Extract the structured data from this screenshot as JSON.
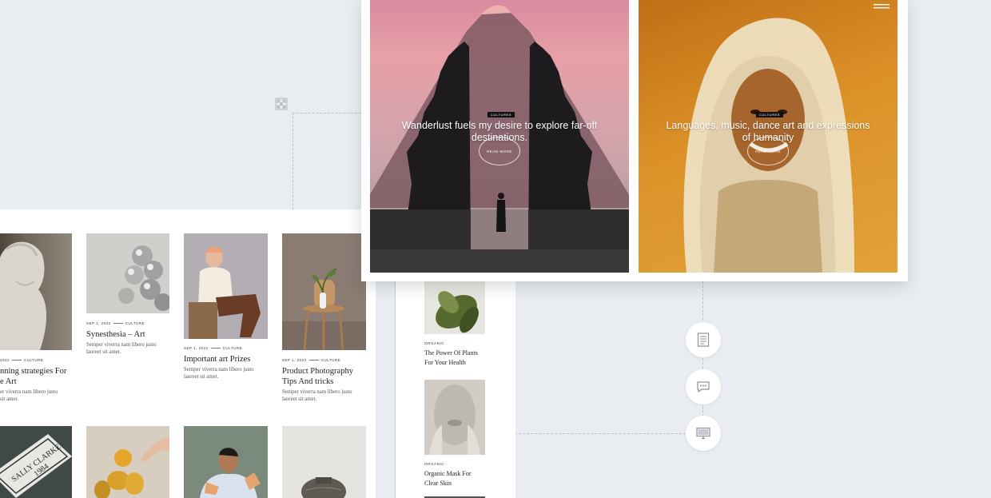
{
  "grid": {
    "row1": [
      {
        "meta_date": "2022",
        "meta_cat": "CULTURE",
        "title": "nning strategies For\ne Art",
        "excerpt": "er viverra nam libero justo\nsit amet."
      },
      {
        "meta_date": "SEP 1, 2022",
        "meta_cat": "CULTURE",
        "title": "Synesthesia – Art",
        "excerpt": "Semper viverra nam libero justo\nlaoreet sit amet."
      },
      {
        "meta_date": "SEP 1, 2022",
        "meta_cat": "CULTURE",
        "title": "Important art Prizes",
        "excerpt": "Semper viverra nam libero justo\nlaoreet sit amet."
      },
      {
        "meta_date": "SEP 1, 2022",
        "meta_cat": "CULTURE",
        "title": "Product Photography\nTips And tricks",
        "excerpt": "Semper viverra nam libero justo\nlaoreet sit amet."
      }
    ]
  },
  "sidebar": {
    "items": [
      {
        "tag": "ORGANIC",
        "title": "The Power Of Plants\nFor Your Health"
      },
      {
        "tag": "ORGANIC",
        "title": "Organic Mask For\nClear Skin"
      }
    ]
  },
  "hero": {
    "slides": [
      {
        "badge": "CULTURES",
        "caption": "Wanderlust fuels my desire to explore far-off\ndestinations.",
        "button": "READ MORE"
      },
      {
        "badge": "CULTURES",
        "caption": "Languages, music, dance art and expressions\nof humanity",
        "button": "READ MORE"
      }
    ]
  },
  "sign_text": "SALLY CLARKE\n1984",
  "icons": {
    "expand": "expand-icon",
    "menu": "hamburger-menu-icon",
    "document": "document-icon",
    "chat": "chat-bubble-icon",
    "monitor": "monitor-icon"
  },
  "colors": {
    "background": "#e9edf1",
    "panel": "#ffffff",
    "connector": "#b9c1ca"
  }
}
